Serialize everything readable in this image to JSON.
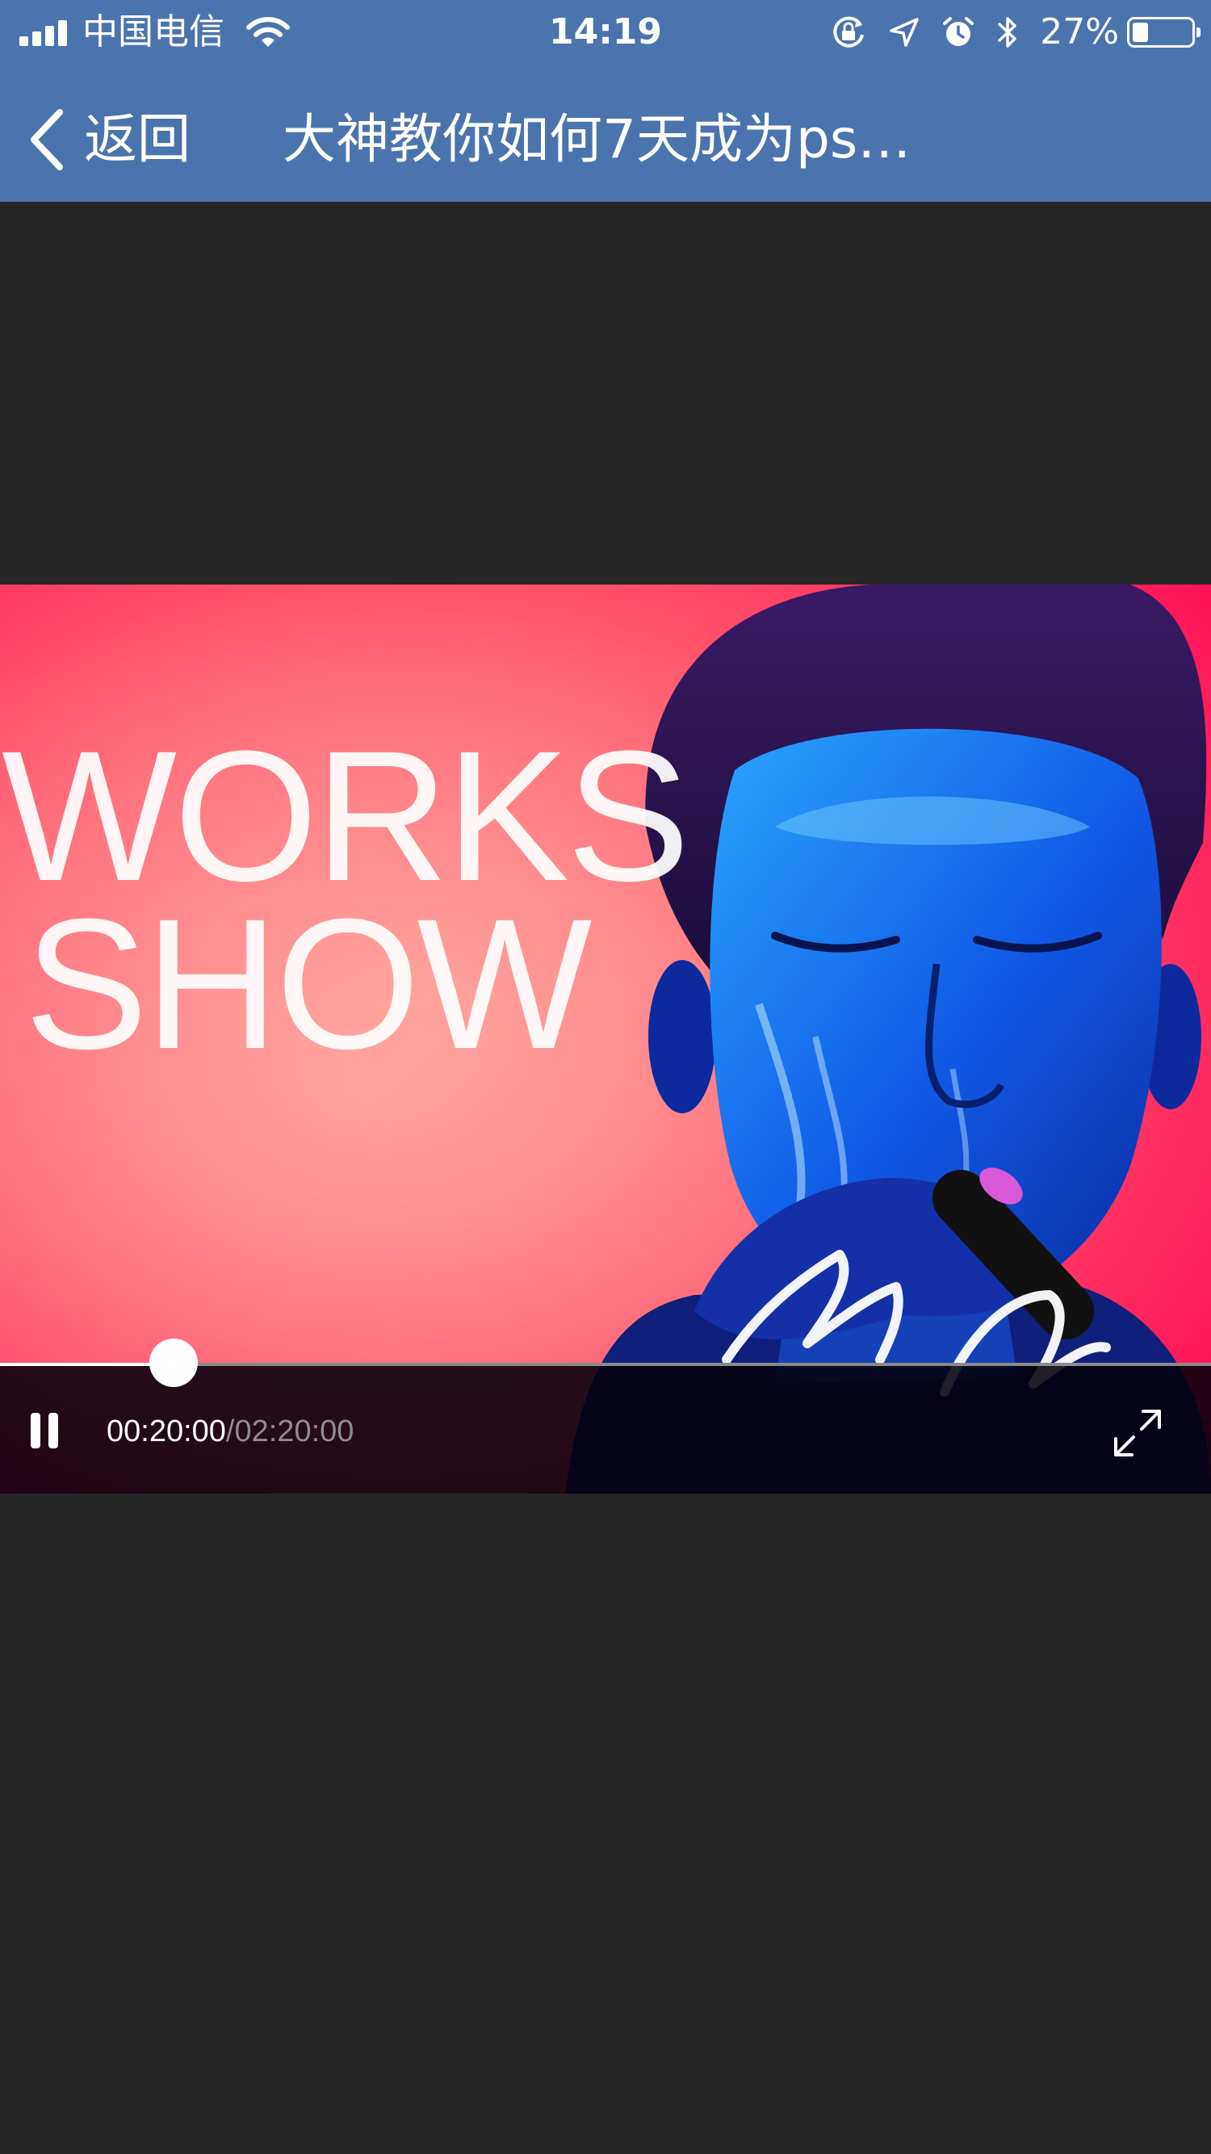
{
  "status_bar": {
    "carrier": "中国电信",
    "time": "14:19",
    "battery_percent": "27%",
    "battery_level": 0.27,
    "icons": [
      "signal-icon",
      "wifi-icon",
      "rotation-lock-icon",
      "location-icon",
      "alarm-icon",
      "bluetooth-icon",
      "battery-icon"
    ]
  },
  "nav": {
    "back_label": "返回",
    "title": "大神教你如何7天成为ps…"
  },
  "video": {
    "poster_line1": "WORKS",
    "poster_line2": "SHOW",
    "current_time": "00:20:00",
    "separator": "/",
    "duration": "02:20:00",
    "progress": 0.143,
    "icons": [
      "pause-icon",
      "fullscreen-icon"
    ]
  },
  "colors": {
    "nav_background": "#4a74ad",
    "page_background": "#252525",
    "poster_pink": "#ff2f5c",
    "poster_blue": "#1f5cff"
  }
}
